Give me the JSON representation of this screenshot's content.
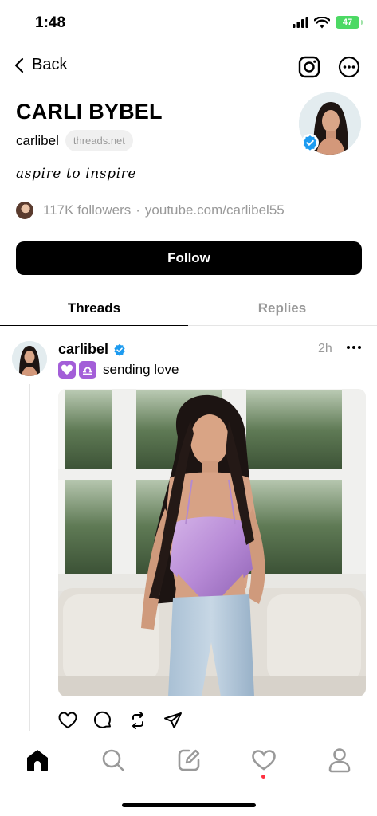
{
  "status_bar": {
    "time": "1:48",
    "battery": "47"
  },
  "nav": {
    "back_label": "Back"
  },
  "profile": {
    "name": "CARLI BYBEL",
    "username": "carlibel",
    "domain_badge": "threads.net",
    "bio": "aspire to inspire",
    "followers": "117K followers",
    "separator": "·",
    "link": "youtube.com/carlibel55"
  },
  "follow_button": {
    "label": "Follow"
  },
  "tabs": [
    {
      "label": "Threads",
      "active": true
    },
    {
      "label": "Replies",
      "active": false
    }
  ],
  "post": {
    "author": "carlibel",
    "time": "2h",
    "text": "sending love",
    "emojis": [
      "purple-heart",
      "libra"
    ]
  },
  "bottom_nav": [
    "home-icon",
    "search-icon",
    "compose-icon",
    "activity-icon",
    "profile-icon"
  ],
  "colors": {
    "accent": "#000000",
    "verified": "#1d9bf0",
    "muted": "#999999",
    "notif": "#ff3040"
  }
}
